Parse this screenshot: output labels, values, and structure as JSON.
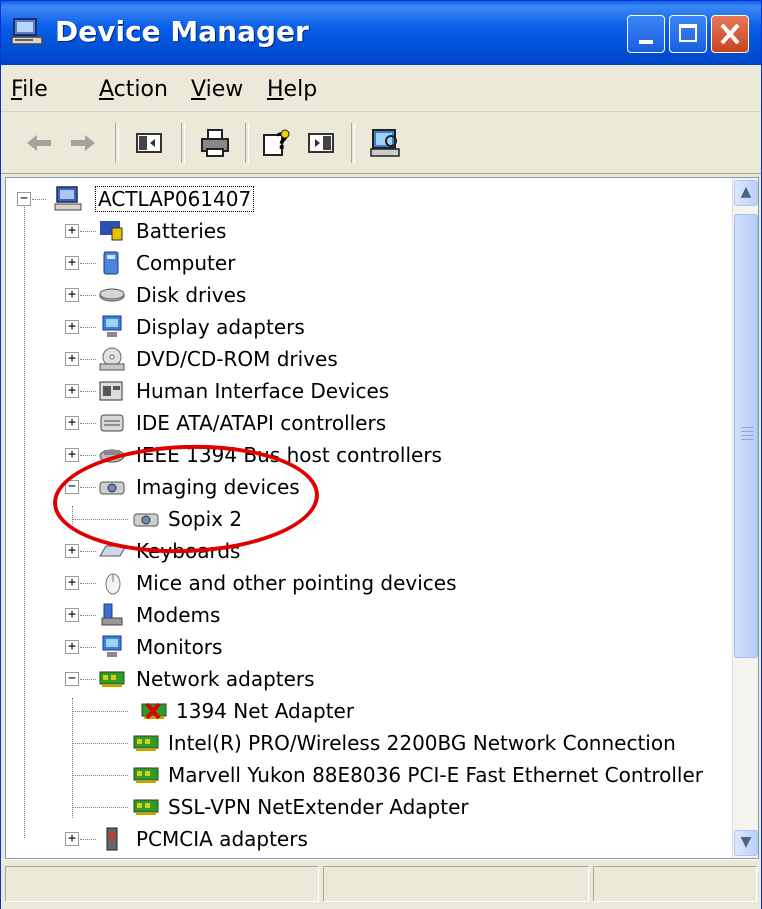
{
  "window": {
    "title": "Device Manager",
    "accent": "#0a5fe9",
    "controls": [
      "minimize-icon",
      "maximize-icon",
      "close-icon"
    ]
  },
  "menu": {
    "file": {
      "underline": "F",
      "rest": "ile"
    },
    "action": {
      "underline": "A",
      "rest": "ction"
    },
    "view": {
      "underline": "V",
      "rest": "iew"
    },
    "help": {
      "underline": "H",
      "rest": "elp"
    }
  },
  "toolbar": {
    "icons": [
      "back-arrow-icon",
      "forward-arrow-icon",
      "show-hide-console-tree-icon",
      "print-icon",
      "help-icon",
      "properties-icon",
      "scan-hardware-icon"
    ]
  },
  "tree": {
    "root": "ACTLAP061407",
    "items": [
      {
        "label": "Batteries",
        "icon": "battery-icon",
        "state": "collapsed"
      },
      {
        "label": "Computer",
        "icon": "computer-icon",
        "state": "collapsed"
      },
      {
        "label": "Disk drives",
        "icon": "disk-drive-icon",
        "state": "collapsed"
      },
      {
        "label": "Display adapters",
        "icon": "display-adapter-icon",
        "state": "collapsed"
      },
      {
        "label": "DVD/CD-ROM drives",
        "icon": "dvd-drive-icon",
        "state": "collapsed"
      },
      {
        "label": "Human Interface Devices",
        "icon": "hid-icon",
        "state": "collapsed"
      },
      {
        "label": "IDE ATA/ATAPI controllers",
        "icon": "ide-controller-icon",
        "state": "collapsed"
      },
      {
        "label": "IEEE 1394 Bus host controllers",
        "icon": "ieee1394-icon",
        "state": "collapsed"
      },
      {
        "label": "Imaging devices",
        "icon": "imaging-device-icon",
        "state": "expanded"
      },
      {
        "label": "Sopix 2",
        "icon": "camera-icon",
        "state": "child"
      },
      {
        "label": "Keyboards",
        "icon": "keyboard-icon",
        "state": "collapsed"
      },
      {
        "label": "Mice and other pointing devices",
        "icon": "mouse-icon",
        "state": "collapsed"
      },
      {
        "label": "Modems",
        "icon": "modem-icon",
        "state": "collapsed"
      },
      {
        "label": "Monitors",
        "icon": "monitor-icon",
        "state": "collapsed"
      },
      {
        "label": "Network adapters",
        "icon": "network-adapter-icon",
        "state": "expanded"
      },
      {
        "label": "1394 Net Adapter",
        "icon": "network-adapter-disabled-icon",
        "state": "child"
      },
      {
        "label": "Intel(R) PRO/Wireless 2200BG Network Connection",
        "icon": "network-adapter-icon",
        "state": "child"
      },
      {
        "label": "Marvell Yukon 88E8036 PCI-E Fast Ethernet Controller",
        "icon": "network-adapter-icon",
        "state": "child"
      },
      {
        "label": "SSL-VPN NetExtender Adapter",
        "icon": "network-adapter-icon",
        "state": "child"
      },
      {
        "label": "PCMCIA adapters",
        "icon": "pcmcia-icon",
        "state": "collapsed"
      }
    ]
  },
  "annotation": {
    "color": "#e00000",
    "shape": "ellipse",
    "target": "Imaging devices"
  },
  "scroll_position": 0.0
}
